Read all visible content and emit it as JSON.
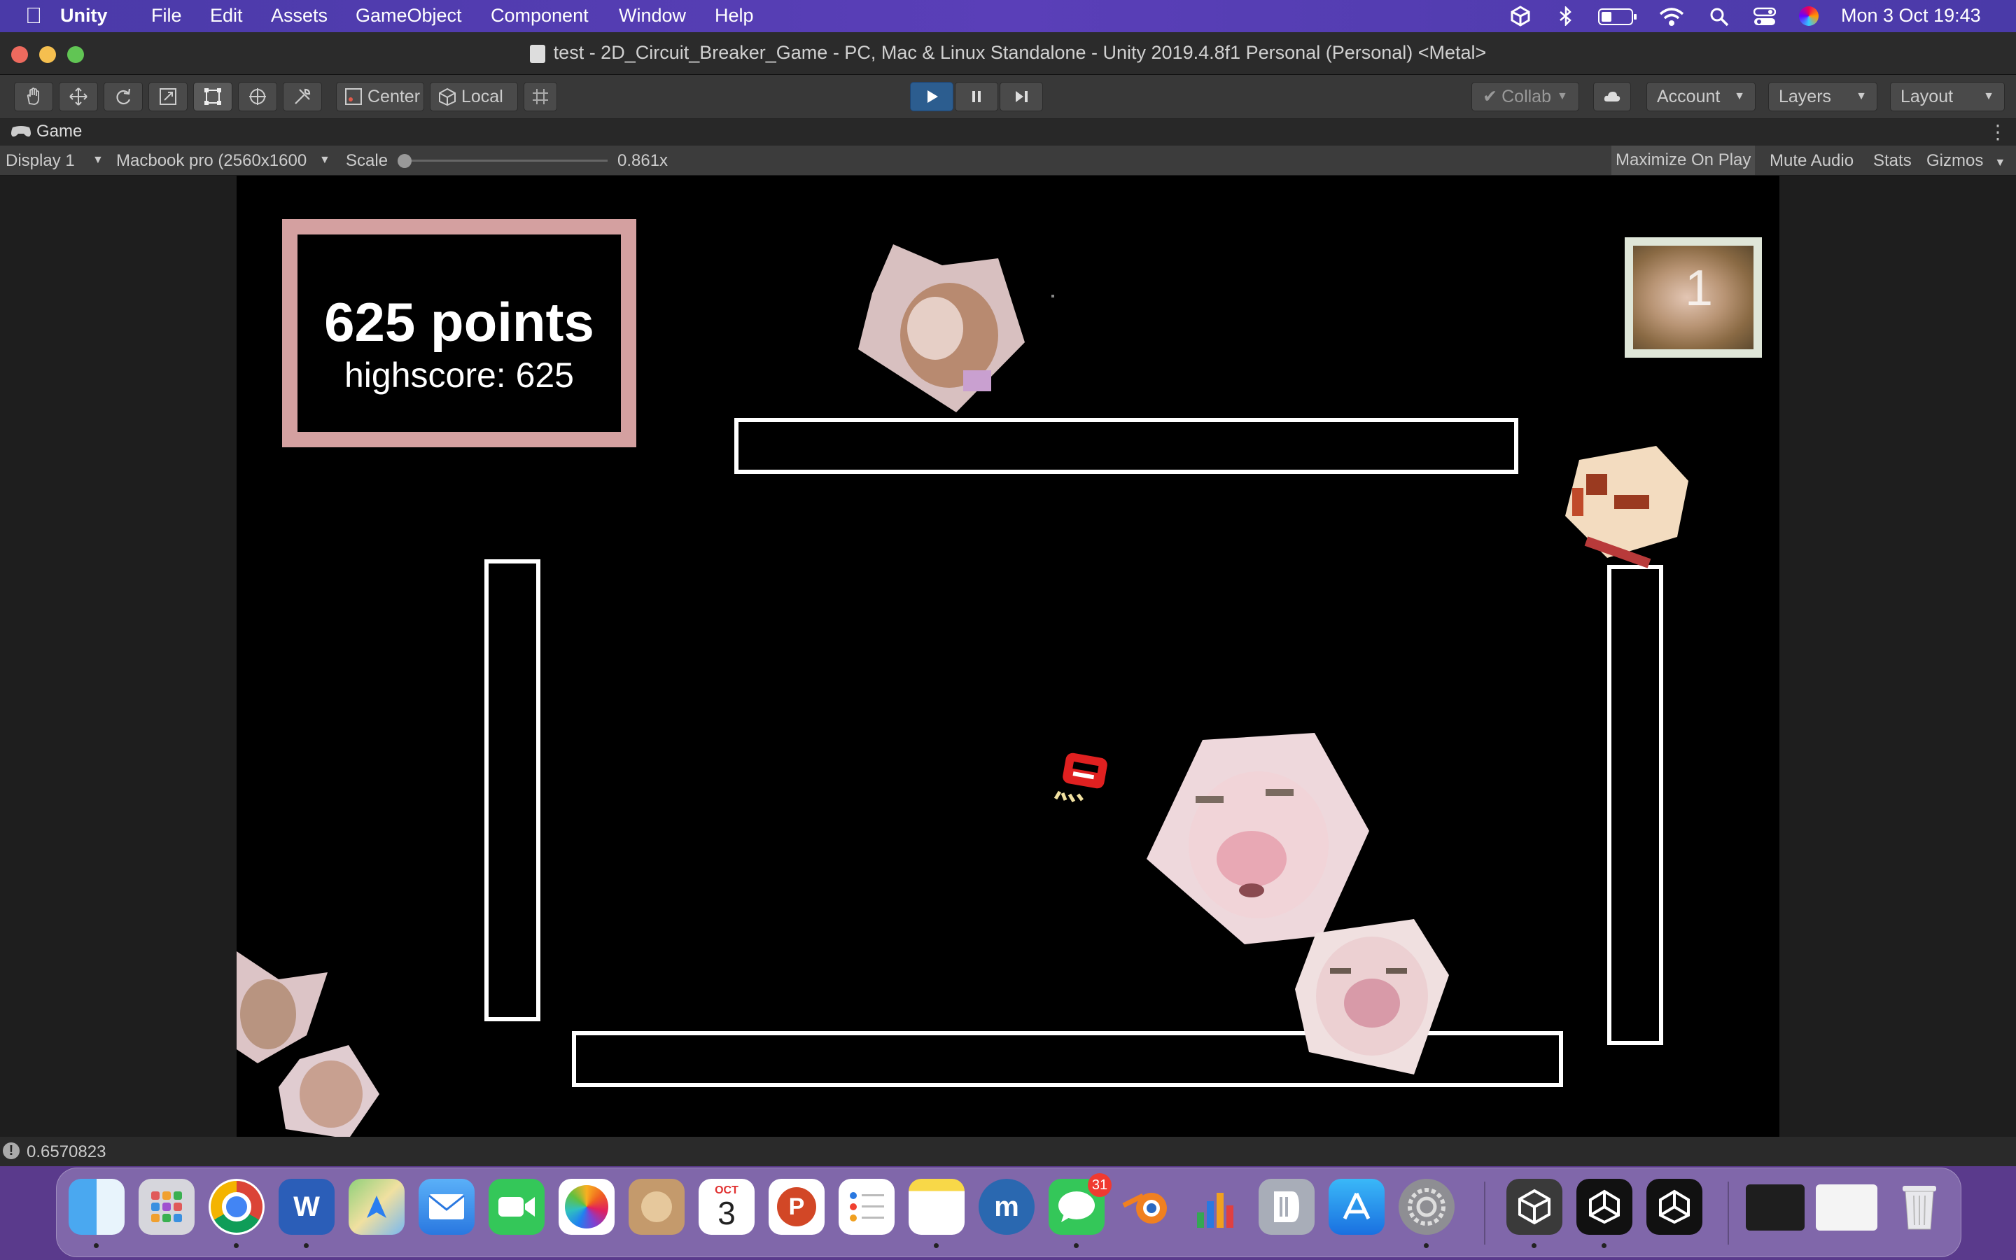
{
  "menubar": {
    "app": "Unity",
    "items": [
      "File",
      "Edit",
      "Assets",
      "GameObject",
      "Component",
      "Window",
      "Help"
    ],
    "datetime": "Mon 3 Oct  19:43"
  },
  "window": {
    "title": "test - 2D_Circuit_Breaker_Game - PC, Mac & Linux Standalone - Unity 2019.4.8f1 Personal (Personal) <Metal>"
  },
  "toolbar": {
    "pivot_center": "Center",
    "pivot_local": "Local",
    "collab": "Collab",
    "account": "Account",
    "layers": "Layers",
    "layout": "Layout"
  },
  "tab": {
    "label": "Game"
  },
  "gamebar": {
    "display": "Display 1",
    "resolution": "Macbook pro (2560x1600",
    "scale_label": "Scale",
    "scale_value": "0.861x",
    "maximize": "Maximize On Play",
    "mute": "Mute Audio",
    "stats": "Stats",
    "gizmos": "Gizmos"
  },
  "game": {
    "score": "625 points",
    "highscore": "highscore: 625",
    "lives_digit": "1"
  },
  "status": {
    "text": "0.6570823"
  },
  "dock": {
    "calendar_month": "OCT",
    "calendar_day": "3",
    "messages_badge": "31",
    "apps": [
      "finder-icon",
      "launchpad-icon",
      "chrome-icon",
      "word-icon",
      "maps-icon",
      "mail-icon",
      "facetime-icon",
      "photos-icon",
      "contacts-icon",
      "calendar-icon",
      "powerpoint-icon",
      "reminders-icon",
      "notes-icon",
      "musescore-icon",
      "messages-icon",
      "blender-icon",
      "numbers-icon",
      "dashlane-icon",
      "appstore-icon",
      "settings-icon",
      "unity-hub-icon",
      "unity-icon",
      "unity-icon-2",
      "window-thumb-1",
      "window-thumb-2",
      "trash-icon"
    ]
  },
  "colors": {
    "score_border": "#d4a0a0",
    "play_active": "#2c5d8f",
    "menubar": "#4a3aa8"
  }
}
